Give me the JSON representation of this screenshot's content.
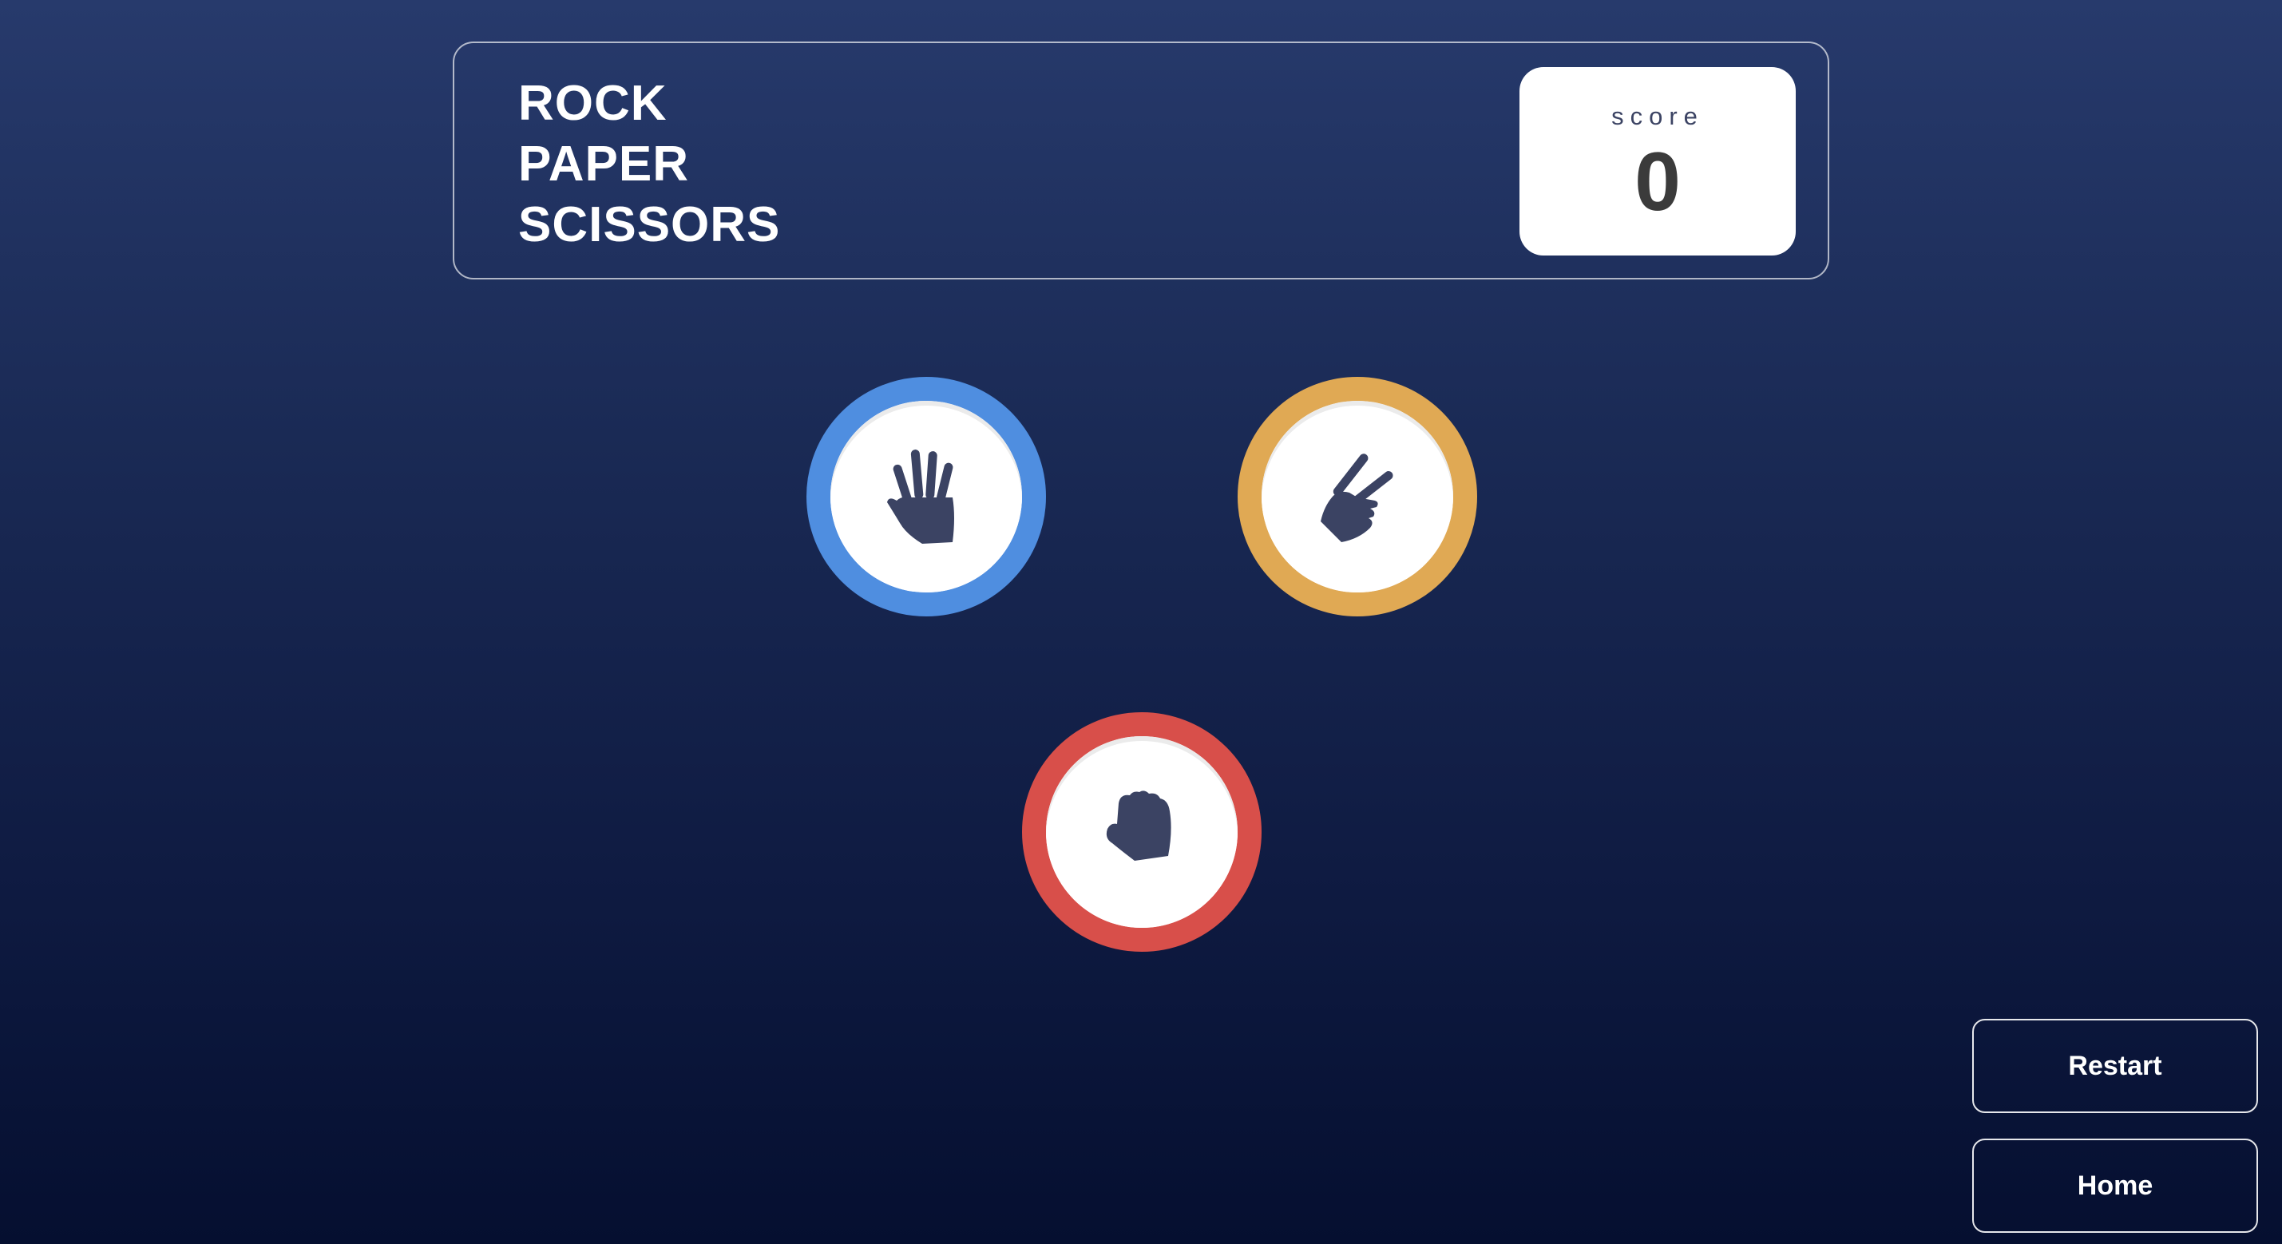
{
  "header": {
    "title_lines": [
      "ROCK",
      "PAPER",
      "SCISSORS"
    ],
    "score_label": "score",
    "score_value": "0"
  },
  "tokens": [
    {
      "name": "paper",
      "icon": "paper-hand-icon",
      "color": "#4f8ee0"
    },
    {
      "name": "scissors",
      "icon": "scissors-hand-icon",
      "color": "#e0a954"
    },
    {
      "name": "rock",
      "icon": "rock-fist-icon",
      "color": "#d84f4a"
    }
  ],
  "buttons": {
    "restart_label": "Restart",
    "home_label": "Home"
  },
  "colors": {
    "icon_fill": "#3b4363",
    "score_text": "#3b3b3b"
  }
}
